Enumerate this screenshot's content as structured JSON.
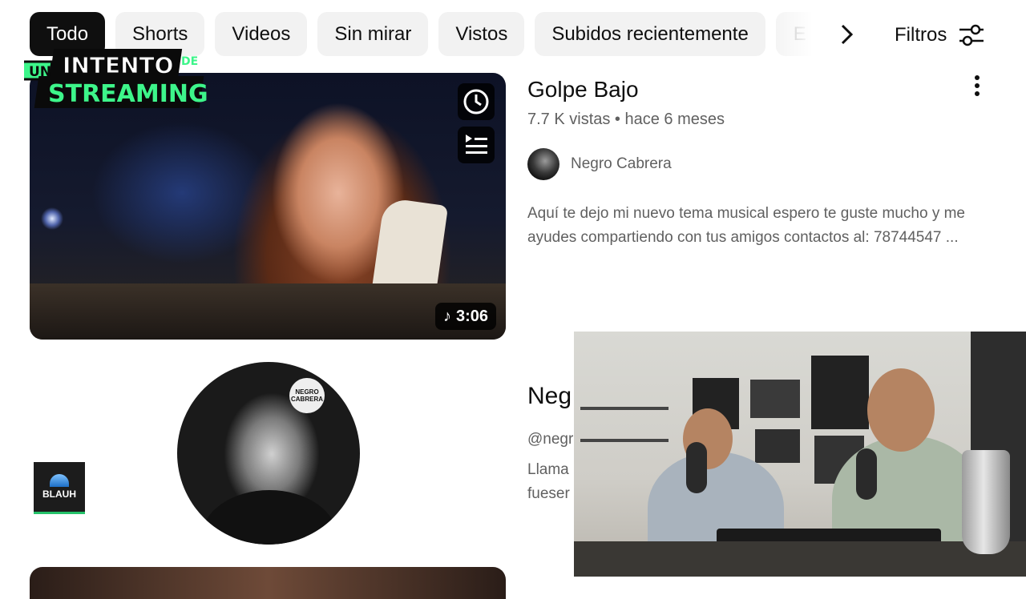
{
  "chips": [
    {
      "label": "Todo",
      "active": true
    },
    {
      "label": "Shorts",
      "active": false
    },
    {
      "label": "Videos",
      "active": false
    },
    {
      "label": "Sin mirar",
      "active": false
    },
    {
      "label": "Vistos",
      "active": false
    },
    {
      "label": "Subidos recientemente",
      "active": false
    },
    {
      "label": "E",
      "active": false
    }
  ],
  "filters": {
    "label": "Filtros"
  },
  "overlay_logo": {
    "line1_prefix": "UN",
    "line1": "INTENTO",
    "line1_suffix": "DE",
    "line2": "STREAMING"
  },
  "video": {
    "title": "Golpe Bajo",
    "meta": "7.7 K vistas • hace 6 meses",
    "duration": "3:06",
    "channel": "Negro Cabrera",
    "description_line1": "Aquí te dejo mi nuevo tema musical espero te guste mucho y me",
    "description_line2": "ayudes compartiendo con tus amigos contactos al: 78744547 ..."
  },
  "channel_result": {
    "name": "Neg",
    "handle": "@negr",
    "desc_line1": "Llama",
    "desc_line2": "fueser",
    "badge_line1": "NEGRO",
    "badge_line2": "CABRERA"
  },
  "watermark": {
    "text": "BLAUH"
  },
  "colors": {
    "chip_active_bg": "#0f0f0f",
    "chip_bg": "#f2f2f2",
    "secondary_text": "#606060",
    "logo_green": "#3df58a",
    "logo_black": "#0a0a0a"
  }
}
